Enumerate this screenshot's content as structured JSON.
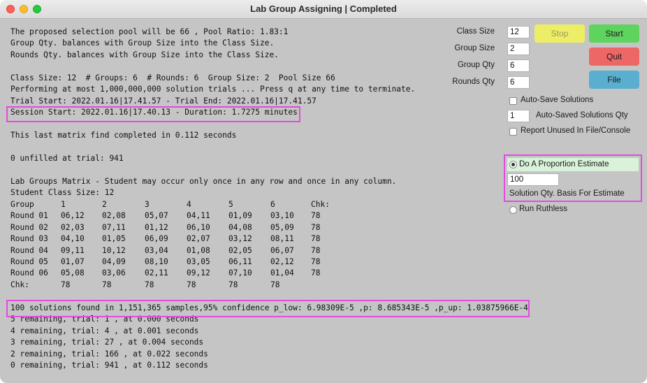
{
  "window": {
    "title": "Lab Group Assigning | Completed"
  },
  "console": {
    "lines_top": [
      "The proposed selection pool will be 66 , Pool Ratio: 1.83:1",
      "Group Qty. balances with Group Size into the Class Size.",
      "Rounds Qty. balances with Group Size into the Class Size.",
      "",
      "Class Size: 12  # Groups: 6  # Rounds: 6  Group Size: 2  Pool Size 66",
      "Performing at most 1,000,000,000 solution trials ... Press q at any time to terminate.",
      "Trial Start: 2022.01.16|17.41.57 - Trial End: 2022.01.16|17.41.57",
      "Session Start: 2022.01.16|17.40.13 - Duration: 1.7275 minutes",
      "",
      "This last matrix find completed in 0.112 seconds",
      "",
      "0 unfilled at trial: 941",
      "",
      "Lab Groups Matrix - Student may occur only once in any row and once in any column.",
      "Student Class Size: 12"
    ],
    "matrix_header": [
      "Group",
      "1",
      "2",
      "3",
      "4",
      "5",
      "6",
      "Chk:"
    ],
    "matrix_rows": [
      [
        "Round 01",
        "06,12",
        "02,08",
        "05,07",
        "04,11",
        "01,09",
        "03,10",
        "78"
      ],
      [
        "Round 02",
        "02,03",
        "07,11",
        "01,12",
        "06,10",
        "04,08",
        "05,09",
        "78"
      ],
      [
        "Round 03",
        "04,10",
        "01,05",
        "06,09",
        "02,07",
        "03,12",
        "08,11",
        "78"
      ],
      [
        "Round 04",
        "09,11",
        "10,12",
        "03,04",
        "01,08",
        "02,05",
        "06,07",
        "78"
      ],
      [
        "Round 05",
        "01,07",
        "04,09",
        "08,10",
        "03,05",
        "06,11",
        "02,12",
        "78"
      ],
      [
        "Round 06",
        "05,08",
        "03,06",
        "02,11",
        "09,12",
        "07,10",
        "01,04",
        "78"
      ]
    ],
    "matrix_footer": [
      "Chk:",
      "78",
      "78",
      "78",
      "78",
      "78",
      "78"
    ],
    "lines_bottom": [
      "",
      "100 solutions found in 1,151,365 samples,95% confidence p_low: 6.98309E-5 ,p: 8.685343E-5 ,p_up: 1.03875966E-4",
      "5 remaining, trial: 1 , at 0.000 seconds",
      "4 remaining, trial: 4 , at 0.001 seconds",
      "3 remaining, trial: 27 , at 0.004 seconds",
      "2 remaining, trial: 166 , at 0.022 seconds",
      "0 remaining, trial: 941 , at 0.112 seconds"
    ]
  },
  "controls": {
    "class_size": {
      "label": "Class Size",
      "value": "12"
    },
    "group_size": {
      "label": "Group Size",
      "value": "2"
    },
    "group_qty": {
      "label": "Group Qty",
      "value": "6"
    },
    "rounds_qty": {
      "label": "Rounds Qty",
      "value": "6"
    },
    "stop_label": "Stop",
    "start_label": "Start",
    "quit_label": "Quit",
    "file_label": "File",
    "auto_save_label": "Auto-Save Solutions",
    "auto_saved_qty_value": "1",
    "auto_saved_qty_label": "Auto-Saved Solutions Qty",
    "report_unused_label": "Report Unused In File/Console",
    "proportion_label": "Do A Proportion Estimate",
    "proportion_value": "100",
    "proportion_basis_label": "Solution Qty. Basis For Estimate",
    "run_ruthless_label": "Run Ruthless"
  },
  "colors": {
    "stop": "#eeee66",
    "start": "#5ed35e",
    "quit": "#ee6767",
    "file": "#5aaed0",
    "highlight": "#e04ce0",
    "selected_option": "#d9f2d9"
  }
}
